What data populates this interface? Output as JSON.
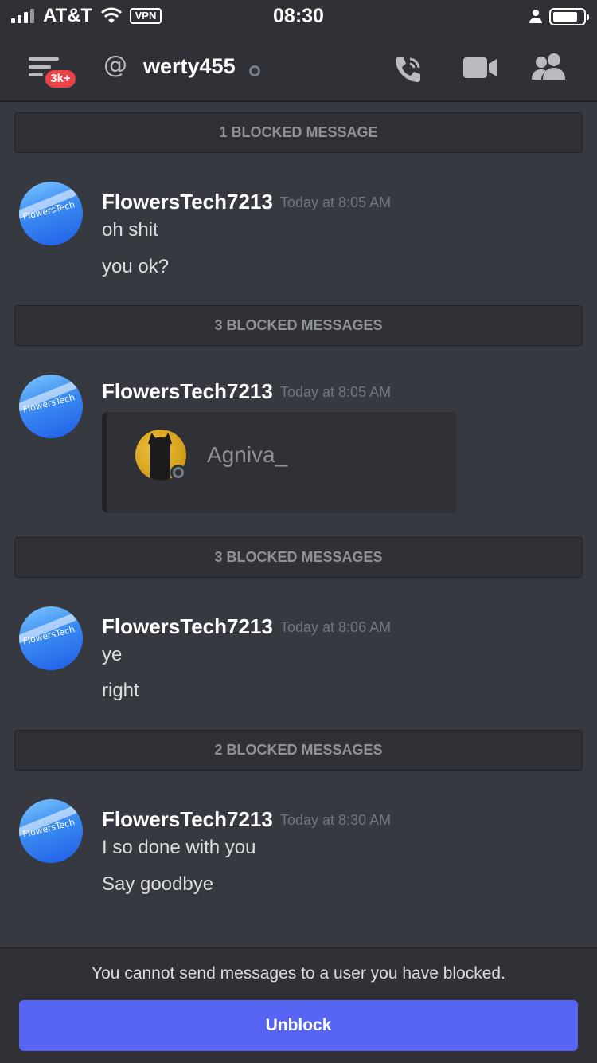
{
  "status_bar": {
    "carrier": "AT&T",
    "vpn_label": "VPN",
    "time": "08:30"
  },
  "header": {
    "notification_count": "3k+",
    "at_symbol": "@",
    "channel_name": "werty455"
  },
  "blocked_groups": [
    {
      "label": "1 BLOCKED MESSAGE"
    },
    {
      "label": "3 BLOCKED MESSAGES"
    },
    {
      "label": "3 BLOCKED MESSAGES"
    },
    {
      "label": "2 BLOCKED MESSAGES"
    }
  ],
  "messages": [
    {
      "author": "FlowersTech7213",
      "avatar_text": "FlowersTech",
      "time": "Today at 8:05 AM",
      "lines": [
        "oh shit",
        "you ok?"
      ]
    },
    {
      "author": "FlowersTech7213",
      "avatar_text": "FlowersTech",
      "time": "Today at 8:05 AM",
      "embed_name": "Agniva_"
    },
    {
      "author": "FlowersTech7213",
      "avatar_text": "FlowersTech",
      "time": "Today at 8:06 AM",
      "lines": [
        "ye",
        "right"
      ]
    },
    {
      "author": "FlowersTech7213",
      "avatar_text": "FlowersTech",
      "time": "Today at 8:30 AM",
      "lines": [
        "I so done with you",
        "Say goodbye"
      ]
    }
  ],
  "footer": {
    "note": "You cannot send messages to a user you have blocked.",
    "unblock_label": "Unblock"
  },
  "colors": {
    "background": "#36393f",
    "header_bg": "#2f3136",
    "accent": "#5865f2",
    "badge": "#ed4245"
  }
}
